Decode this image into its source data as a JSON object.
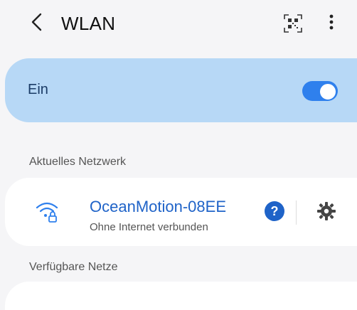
{
  "header": {
    "title": "WLAN",
    "back_icon": "chevron-left-icon",
    "qr_icon": "qr-code-scanner-icon",
    "more_icon": "more-vertical-icon"
  },
  "master_switch": {
    "label": "Ein",
    "state": "on",
    "accent": "#2f80ed",
    "background": "#b7d8f6"
  },
  "current_network": {
    "section_title": "Aktuelles Netzwerk",
    "name": "OceanMotion-08EE",
    "status": "Ohne Internet verbunden",
    "wifi_icon": "wifi-lock-icon",
    "help_icon_glyph": "?",
    "settings_icon": "gear-icon"
  },
  "available_networks": {
    "section_title": "Verfügbare Netze"
  }
}
